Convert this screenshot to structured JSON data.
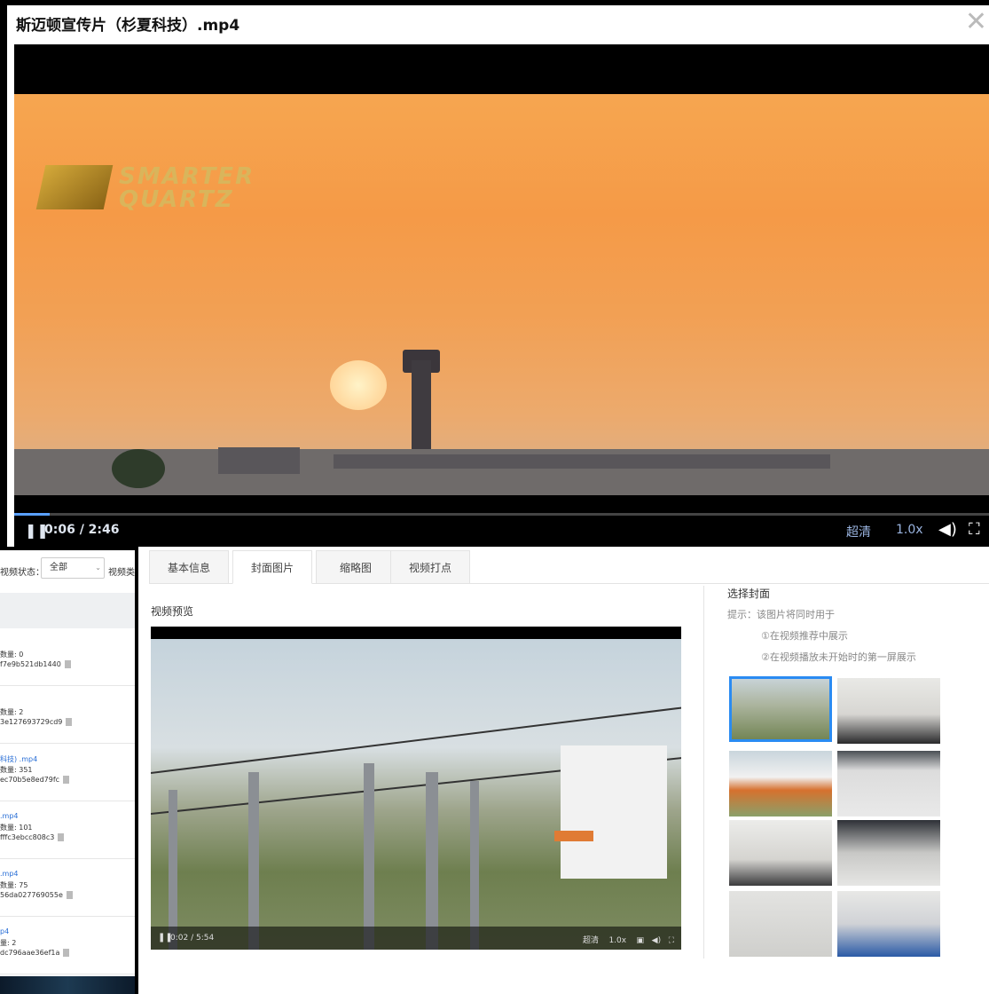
{
  "modal": {
    "title": "斯迈顿宣传片（杉夏科技）.mp4",
    "close_icon": "close-icon",
    "video": {
      "logo_line1": "SMARTER",
      "logo_line2": "QUARTZ",
      "time": "0:06 / 2:46",
      "progress_fraction": 0.036,
      "quality": "超清",
      "speed": "1.0x",
      "volume_icon": "volume-icon",
      "fullscreen_icon": "fullscreen-icon",
      "pause_icon": "pause-icon"
    }
  },
  "left_panel": {
    "filter_label": "视频状态：",
    "filter_value": "全部",
    "filter_label2": "视频类",
    "rows": [
      {
        "line1": "",
        "line2": "数量: 0",
        "line3": "f7e9b521db1440"
      },
      {
        "line1": "",
        "line2": "数量: 2",
        "line3": "3e127693729cd9"
      },
      {
        "line1": "科技) .mp4",
        "line2": "数量: 351",
        "line3": "ec70b5e8ed79fc"
      },
      {
        "line1": ".mp4",
        "line2": "数量: 101",
        "line3": "fffc3ebcc808c3"
      },
      {
        "line1": ".mp4",
        "line2": "数量: 75",
        "line3": "56da027769055e"
      },
      {
        "line1": "p4",
        "line2": "量: 2",
        "line3": "dc796aae36ef1a"
      }
    ]
  },
  "main_panel": {
    "tabs": [
      {
        "label": "基本信息",
        "active": false
      },
      {
        "label": "封面图片",
        "active": true
      },
      {
        "label": "缩略图",
        "active": false
      },
      {
        "label": "视频打点",
        "active": false
      }
    ],
    "preview_title": "视频预览",
    "preview_controls": {
      "time": "0:02 / 5:54",
      "quality": "超清",
      "speed": "1.0x"
    },
    "cover": {
      "title": "选择封面",
      "hint": "提示：该图片将同时用于",
      "hint_line1": "①在视频推荐中展示",
      "hint_line2": "②在视频播放未开始时的第一屏展示",
      "selected_index": 0
    }
  },
  "colors": {
    "accent": "#2a8bf2",
    "link": "#2a6fd6",
    "sunset": "#f59a47"
  }
}
